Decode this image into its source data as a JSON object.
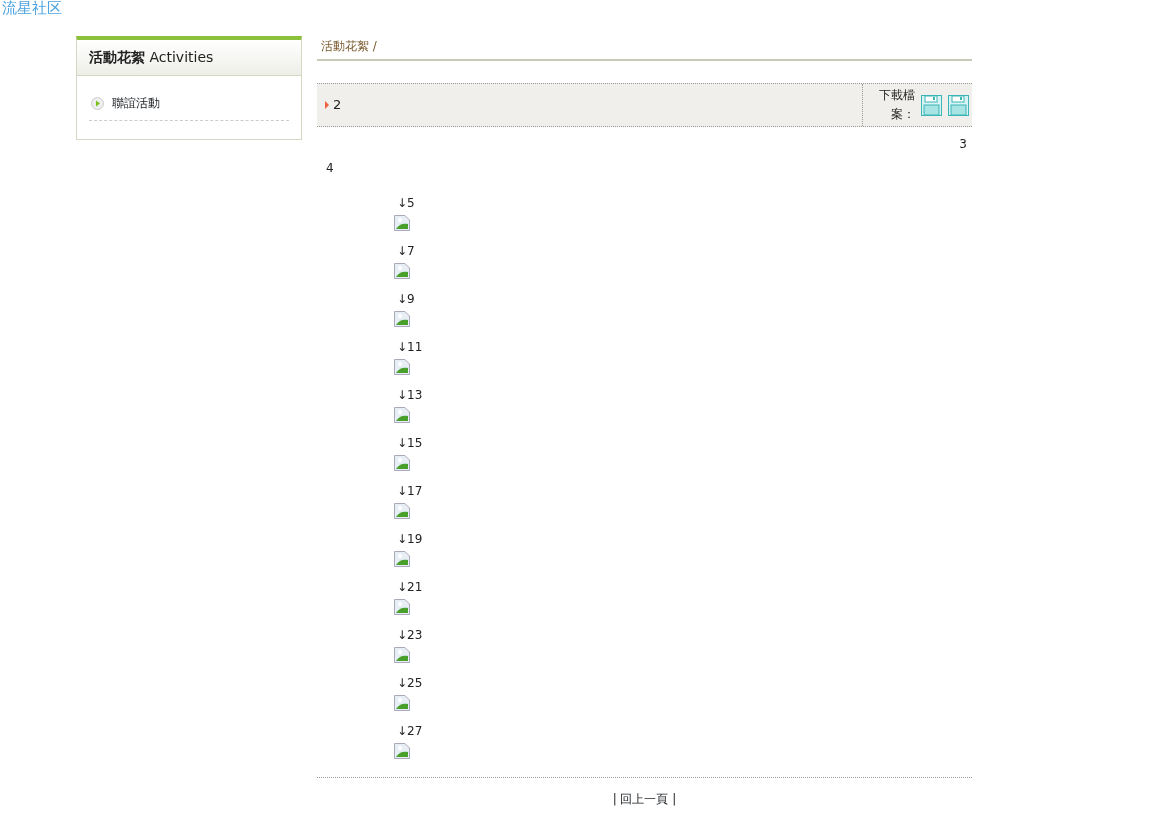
{
  "logo": "流星社区",
  "sidebar": {
    "title": "**活動花絮** Activities",
    "items": [
      {
        "label": "聯誼活動"
      }
    ]
  },
  "breadcrumb": "活動花絮 /",
  "header": {
    "title": "2",
    "download_label": "下載檔案："
  },
  "text_3": "3",
  "text_4": "4",
  "photos": [
    {
      "caption": "↓5"
    },
    {
      "caption": "↓7"
    },
    {
      "caption": "↓9"
    },
    {
      "caption": "↓11"
    },
    {
      "caption": "↓13"
    },
    {
      "caption": "↓15"
    },
    {
      "caption": "↓17"
    },
    {
      "caption": "↓19"
    },
    {
      "caption": "↓21"
    },
    {
      "caption": "↓23"
    },
    {
      "caption": "↓25"
    },
    {
      "caption": "↓27"
    }
  ],
  "back_link": "| 回上一頁 |"
}
